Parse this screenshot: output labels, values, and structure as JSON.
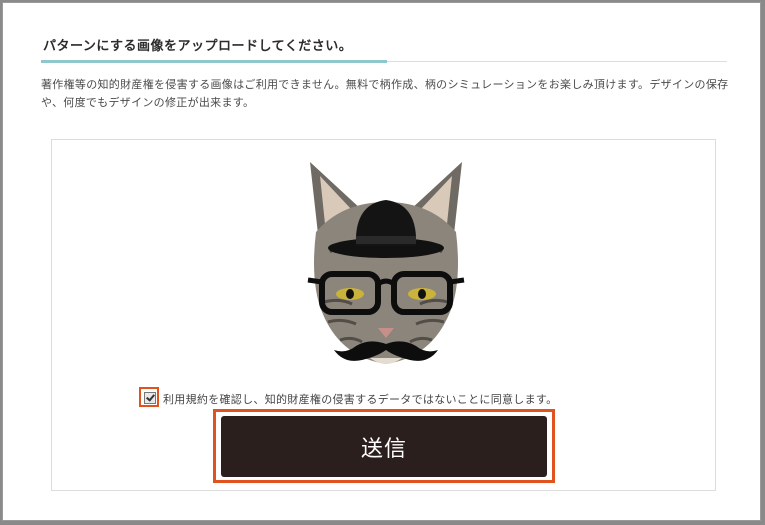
{
  "page": {
    "heading": "パターンにする画像をアップロードしてください。",
    "notice": "著作権等の知的財産権を侵害する画像はご利用できません。無料で柄作成、柄のシミュレーションをお楽しみ頂けます。デザインの保存や、何度でもデザインの修正が出来ます。"
  },
  "upload": {
    "preview_image": "cat-with-hat-glasses-mustache"
  },
  "agreement": {
    "checked": true,
    "label": "利用規約を確認し、知的財産権の侵害するデータではないことに同意します。"
  },
  "submit": {
    "label": "送信"
  },
  "colors": {
    "highlight": "#e0521e",
    "button": "#2a1f1c",
    "heading_accent": "#8fc7cc"
  }
}
